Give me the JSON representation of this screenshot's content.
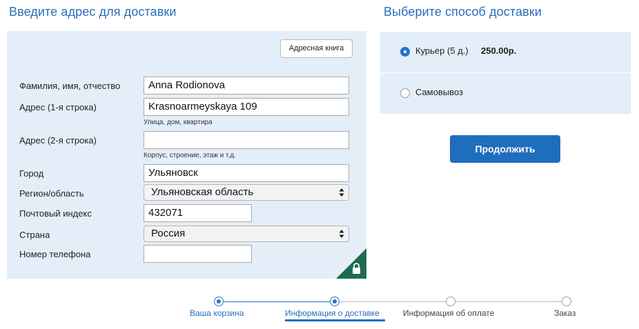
{
  "address_section": {
    "title": "Введите адрес для доставки",
    "address_book_button": "Адресная книга",
    "fields": {
      "full_name": {
        "label": "Фамилия, имя, отчество",
        "value": "Anna Rodionova"
      },
      "address1": {
        "label": "Адрес (1-я строка)",
        "value": "Krasnoarmeyskaya 109",
        "hint": "Улица, дом, квартира"
      },
      "address2": {
        "label": "Адрес (2-я строка)",
        "value": "",
        "hint": "Корпус, строение, этаж и т.д."
      },
      "city": {
        "label": "Город",
        "value": "Ульяновск"
      },
      "region": {
        "label": "Регион/область",
        "selected": "Ульяновская область"
      },
      "postal": {
        "label": "Почтовый индекс",
        "value": "432071"
      },
      "country": {
        "label": "Страна",
        "selected": "Россия"
      },
      "phone": {
        "label": "Номер телефона",
        "value": ""
      }
    },
    "lock_icon": "lock-icon",
    "panel_color": "#e4eef8",
    "lock_color": "#1e6b52"
  },
  "shipping_section": {
    "title": "Выберите способ доставки",
    "options": [
      {
        "label": "Курьер (5 д.)",
        "price": "250.00р.",
        "selected": true
      },
      {
        "label": "Самовывоз",
        "price": "",
        "selected": false
      }
    ],
    "continue_button": "Продолжить"
  },
  "stepper": {
    "steps": [
      {
        "label": "Ваша корзина",
        "state": "done",
        "is_link": true
      },
      {
        "label": "Информация о доставке",
        "state": "current",
        "is_link": true
      },
      {
        "label": "Информация об оплате",
        "state": "pending",
        "is_link": false
      },
      {
        "label": "Заказ",
        "state": "pending",
        "is_link": false
      }
    ]
  },
  "colors": {
    "accent": "#1f6ebe",
    "title_blue": "#2a6cbc",
    "panel_bg": "#e4eef8"
  }
}
